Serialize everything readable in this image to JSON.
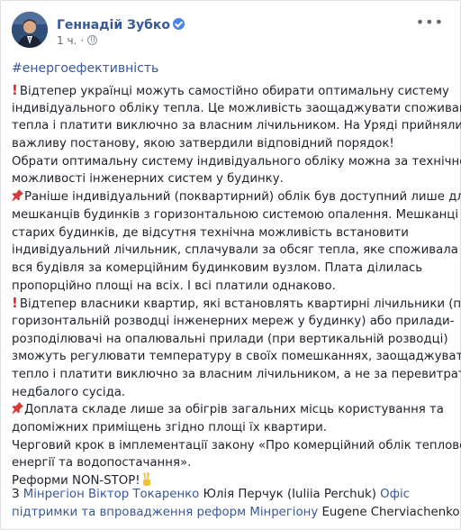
{
  "author": {
    "name": "Геннадій Зубко",
    "time": "1 ч.",
    "separator": "·"
  },
  "hashtag": "#енергоефективність",
  "post_lines": [
    {
      "emoji": "excl",
      "text": "Відтепер українці можуть самостійно обирати оптимальну систему"
    },
    {
      "emoji": "",
      "text": "індивідуального обліку тепла. Це можливість заощаджувати споживання"
    },
    {
      "emoji": "",
      "text": "тепла і платити виключно за власним лічильником. На Уряді прийняли"
    },
    {
      "emoji": "",
      "text": "важливу постанову, якою затвердили відповідний порядок!"
    },
    {
      "emoji": "",
      "text": "Обрати оптимальну систему індивідуального обліку можна за технічної"
    },
    {
      "emoji": "",
      "text": "можливості інженерних систем у будинку."
    },
    {
      "emoji": "pin",
      "text": "Раніше індивідуальний (поквартирний) облік був доступний лише для"
    },
    {
      "emoji": "",
      "text": "мешканців будинків з горизонтальною системою опалення. Мешканці"
    },
    {
      "emoji": "",
      "text": "старих будинків, де відсутня технічна можливість встановити"
    },
    {
      "emoji": "",
      "text": "індивідуальний лічильник, сплачували за обсяг тепла, яке споживала"
    },
    {
      "emoji": "",
      "text": "вся будівля за комерційним будинковим вузлом. Плата ділилась"
    },
    {
      "emoji": "",
      "text": "пропорційно площі на всіх. І всі платили однаково."
    },
    {
      "emoji": "excl",
      "text": "Відтепер власники квартир, які встановлять квартирні лічильники (при"
    },
    {
      "emoji": "",
      "text": "горизонтальній розводці інженерних мереж у будинку) або прилади-"
    },
    {
      "emoji": "",
      "text": "розподілювачі на опалювальні прилади (при вертикальній розводці)"
    },
    {
      "emoji": "",
      "text": "зможуть регулювати температуру в своїх помешканнях, заощаджувати"
    },
    {
      "emoji": "",
      "text": "тепло і платити виключно за власним лічильником, а не за перевитрати"
    },
    {
      "emoji": "",
      "text": "недбалого сусіда."
    },
    {
      "emoji": "pin",
      "text": "Доплата складе лише за обігрів загальних місць користування та"
    },
    {
      "emoji": "",
      "text": "допоміжних приміщень згідно площі їх квартири."
    },
    {
      "emoji": "",
      "text": "Черговий крок в імплементації закону «Про комерційний облік теплової"
    },
    {
      "emoji": "",
      "text": "енергії та водопостачання»."
    },
    {
      "emoji": "",
      "text": "Реформи NON-STOP!",
      "trail": "victory"
    }
  ],
  "with_tags": {
    "prefix": "З ",
    "tag1": "Мінрегіон",
    "tag2": "Віктор Токаренко",
    "tag3": "Юлія Перчук (Iuliia Perchuk)",
    "tag4": "Офіс",
    "tag5": "підтримки та впровадження реформ Мінрегіону",
    "tag6": "Eugene Cherviachenko"
  },
  "icons": {
    "excl": "❗",
    "pin": "📌",
    "victory": "✌"
  }
}
